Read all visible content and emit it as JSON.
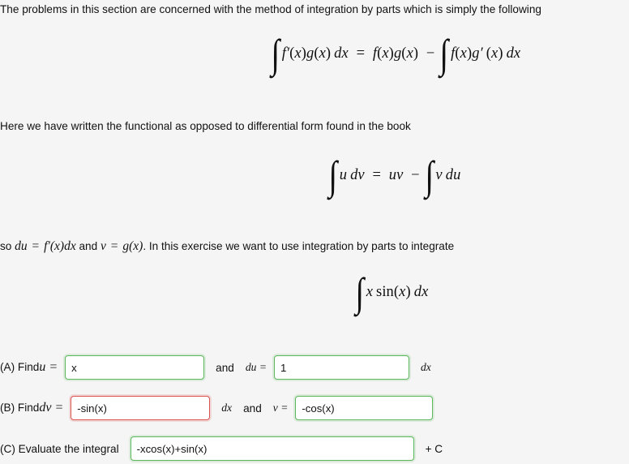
{
  "document": {
    "intro_paragraph": "The problems in this section are concerned with the method of integration by parts which is simply the following",
    "second_paragraph": "Here we have written the functional as opposed to differential form found in the book",
    "third_paragraph_prefix": "so ",
    "third_paragraph_mid": " and ",
    "third_paragraph_suffix": ". In this exercise we want to use integration by parts to integrate"
  },
  "equations": {
    "parts_functional": {
      "integral_sign": "∫",
      "lhs_integrand": "f′(x)g(x) dx",
      "relation": "=",
      "rhs_first": "f(x)g(x)",
      "minus": "−",
      "rhs_integrand": "f(x)g′(x) dx",
      "plain": "∫ f′(x)g(x) dx = f(x)g(x) − ∫ f(x)g′(x) dx"
    },
    "parts_differential": {
      "integral_sign": "∫",
      "lhs_integrand": "u dv",
      "relation": "=",
      "rhs_first": "uv",
      "minus": "−",
      "rhs_integrand": "v du",
      "plain": "∫ u dv = uv − ∫ v du"
    },
    "target_integral": {
      "integral_sign": "∫",
      "integrand": "x sin(x) dx",
      "plain": "∫ x sin(x) dx"
    },
    "inline": {
      "du_def": "du = f′(x)dx",
      "v_def": "v = g(x)"
    }
  },
  "answers": {
    "part_a": {
      "label_prefix": "(A) Find ",
      "label_symbol": "u =",
      "field_u_value": "x",
      "field_u_status": "correct",
      "connector": "and",
      "label_symbol2": "du =",
      "field_du_value": "1",
      "field_du_status": "correct",
      "trailing": "dx"
    },
    "part_b": {
      "label_prefix": "(B) Find ",
      "label_symbol": "dv =",
      "field_dv_value": "-sin(x)",
      "field_dv_status": "incorrect",
      "middle": "dx",
      "connector": "and",
      "label_symbol2": "v =",
      "field_v_value": "-cos(x)",
      "field_v_status": "correct"
    },
    "part_c": {
      "label": "(C) Evaluate the integral",
      "field_value": "-xcos(x)+sin(x)",
      "field_status": "correct",
      "trailing": "+ C"
    }
  },
  "colors": {
    "background": "#f5f5f5",
    "text": "#111111",
    "correct_border": "#5cb85c",
    "incorrect_border": "#d9534f",
    "input_background": "#ffffff"
  }
}
